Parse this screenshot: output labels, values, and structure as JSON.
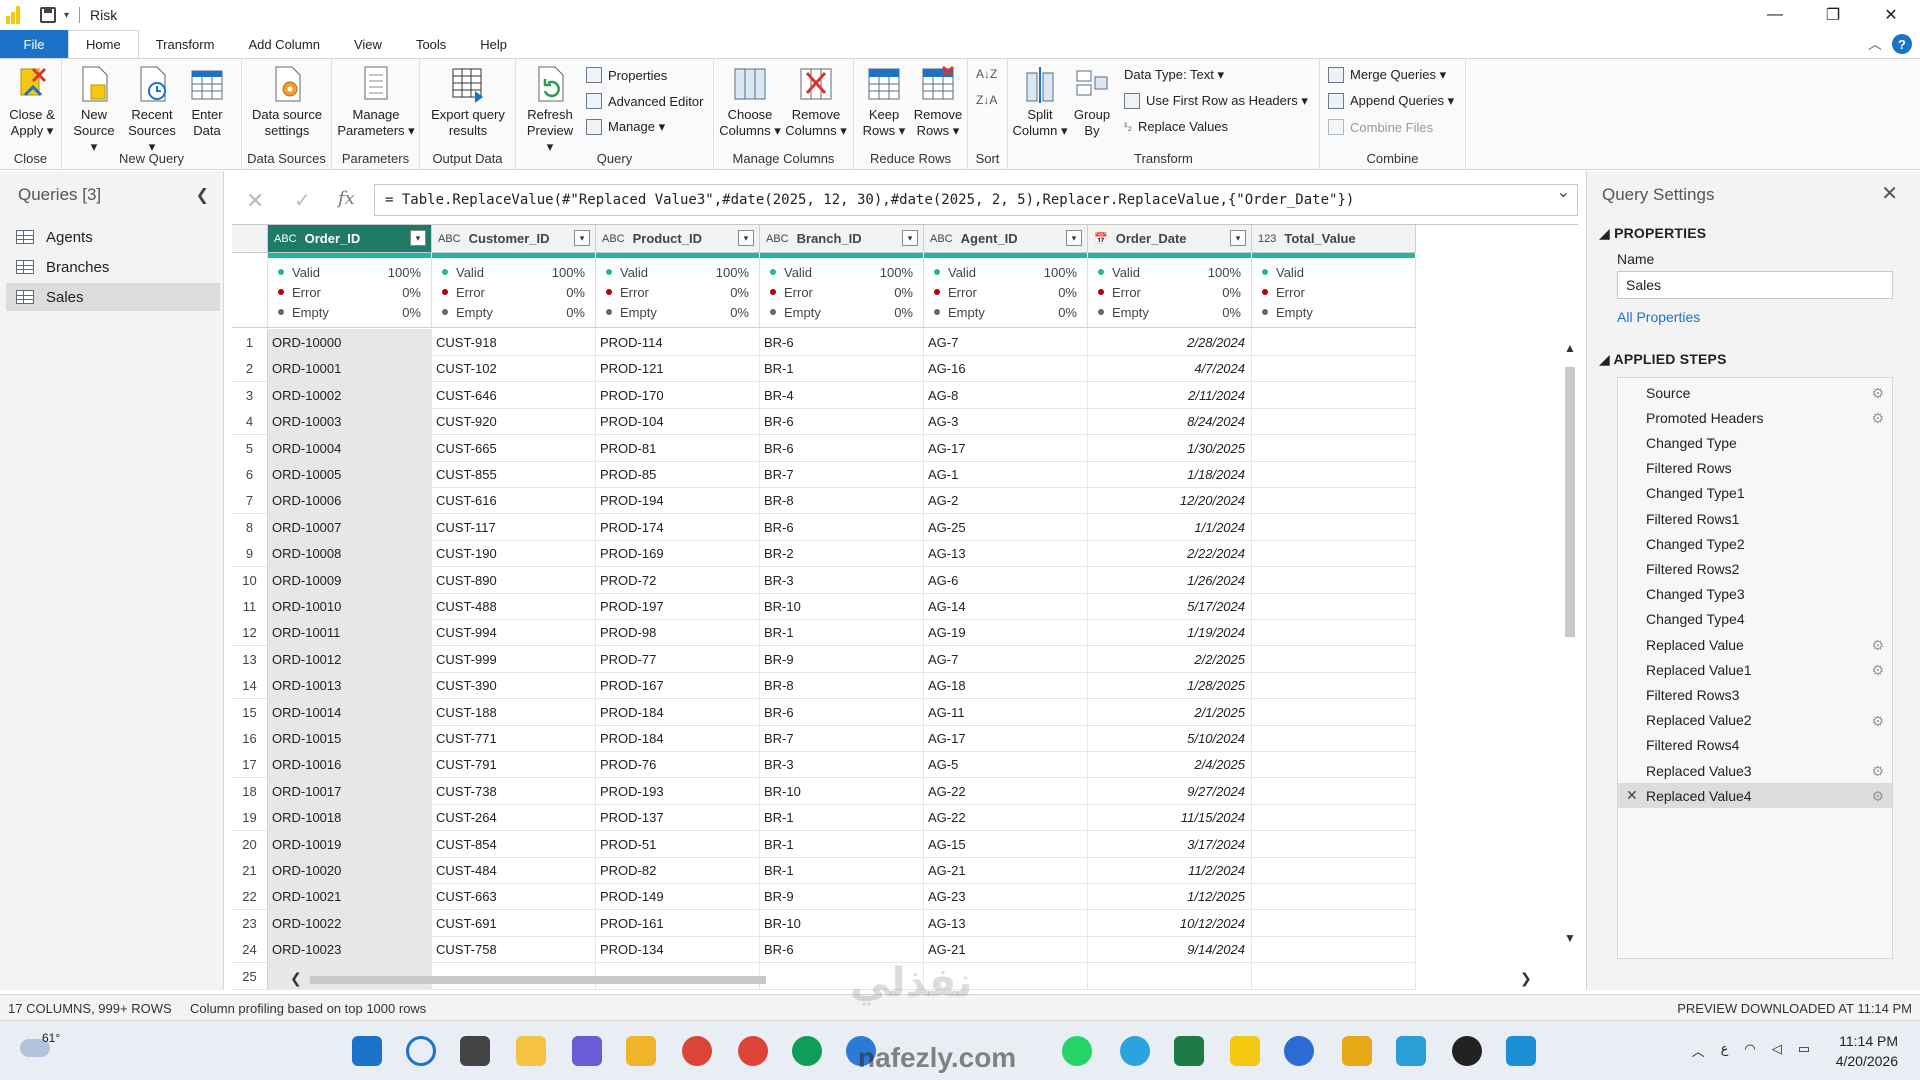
{
  "titlebar": {
    "title": "Risk",
    "minimize": "—",
    "restore": "❐",
    "close": "✕"
  },
  "menu": {
    "tabs": [
      "File",
      "Home",
      "Transform",
      "Add Column",
      "View",
      "Tools",
      "Help"
    ],
    "help_icon": "?"
  },
  "ribbon": {
    "close_apply": "Close &\nApply ▾",
    "new_source": "New\nSource ▾",
    "recent_sources": "Recent\nSources ▾",
    "enter_data": "Enter\nData",
    "data_source_settings": "Data source\nsettings",
    "manage_parameters": "Manage\nParameters ▾",
    "export_query": "Export query\nresults",
    "refresh_preview": "Refresh\nPreview ▾",
    "properties": "Properties",
    "advanced_editor": "Advanced Editor",
    "manage": "Manage ▾",
    "choose_columns": "Choose\nColumns ▾",
    "remove_columns": "Remove\nColumns ▾",
    "keep_rows": "Keep\nRows ▾",
    "remove_rows": "Remove\nRows ▾",
    "split_column": "Split\nColumn ▾",
    "group_by": "Group\nBy",
    "data_type": "Data Type: Text ▾",
    "first_row_headers": "Use First Row as Headers ▾",
    "replace_values": "Replace Values",
    "merge_queries": "Merge Queries ▾",
    "append_queries": "Append Queries ▾",
    "combine_files": "Combine Files",
    "groups": [
      "Close",
      "New Query",
      "Data Sources",
      "Parameters",
      "Output Data",
      "Query",
      "Manage Columns",
      "Reduce Rows",
      "Sort",
      "Transform",
      "Combine"
    ]
  },
  "queries": {
    "header": "Queries [3]",
    "collapse_icon": "❮",
    "items": [
      "Agents",
      "Branches",
      "Sales"
    ],
    "selected": "Sales"
  },
  "formula": {
    "cancel_icon": "✕",
    "commit_icon": "✓",
    "fx": "fx",
    "text": "= Table.ReplaceValue(#\"Replaced Value3\",#date(2025, 12, 30),#date(2025, 2, 5),Replacer.ReplaceValue,{\"Order_Date\"})",
    "expand_icon": "⌄"
  },
  "grid": {
    "columns": [
      {
        "name": "Order_ID",
        "type": "ABC"
      },
      {
        "name": "Customer_ID",
        "type": "ABC"
      },
      {
        "name": "Product_ID",
        "type": "ABC"
      },
      {
        "name": "Branch_ID",
        "type": "ABC"
      },
      {
        "name": "Agent_ID",
        "type": "ABC"
      },
      {
        "name": "Order_Date",
        "type": "📅"
      },
      {
        "name": "Total_Value",
        "type": "123"
      }
    ],
    "profile": {
      "valid": "Valid",
      "error": "Error",
      "empty": "Empty",
      "valid_pct": "100%",
      "error_pct": "0%",
      "empty_pct": "0%"
    },
    "rows": [
      [
        "1",
        "ORD-10000",
        "CUST-918",
        "PROD-114",
        "BR-6",
        "AG-7",
        "2/28/2024"
      ],
      [
        "2",
        "ORD-10001",
        "CUST-102",
        "PROD-121",
        "BR-1",
        "AG-16",
        "4/7/2024"
      ],
      [
        "3",
        "ORD-10002",
        "CUST-646",
        "PROD-170",
        "BR-4",
        "AG-8",
        "2/11/2024"
      ],
      [
        "4",
        "ORD-10003",
        "CUST-920",
        "PROD-104",
        "BR-6",
        "AG-3",
        "8/24/2024"
      ],
      [
        "5",
        "ORD-10004",
        "CUST-665",
        "PROD-81",
        "BR-6",
        "AG-17",
        "1/30/2025"
      ],
      [
        "6",
        "ORD-10005",
        "CUST-855",
        "PROD-85",
        "BR-7",
        "AG-1",
        "1/18/2024"
      ],
      [
        "7",
        "ORD-10006",
        "CUST-616",
        "PROD-194",
        "BR-8",
        "AG-2",
        "12/20/2024"
      ],
      [
        "8",
        "ORD-10007",
        "CUST-117",
        "PROD-174",
        "BR-6",
        "AG-25",
        "1/1/2024"
      ],
      [
        "9",
        "ORD-10008",
        "CUST-190",
        "PROD-169",
        "BR-2",
        "AG-13",
        "2/22/2024"
      ],
      [
        "10",
        "ORD-10009",
        "CUST-890",
        "PROD-72",
        "BR-3",
        "AG-6",
        "1/26/2024"
      ],
      [
        "11",
        "ORD-10010",
        "CUST-488",
        "PROD-197",
        "BR-10",
        "AG-14",
        "5/17/2024"
      ],
      [
        "12",
        "ORD-10011",
        "CUST-994",
        "PROD-98",
        "BR-1",
        "AG-19",
        "1/19/2024"
      ],
      [
        "13",
        "ORD-10012",
        "CUST-999",
        "PROD-77",
        "BR-9",
        "AG-7",
        "2/2/2025"
      ],
      [
        "14",
        "ORD-10013",
        "CUST-390",
        "PROD-167",
        "BR-8",
        "AG-18",
        "1/28/2025"
      ],
      [
        "15",
        "ORD-10014",
        "CUST-188",
        "PROD-184",
        "BR-6",
        "AG-11",
        "2/1/2025"
      ],
      [
        "16",
        "ORD-10015",
        "CUST-771",
        "PROD-184",
        "BR-7",
        "AG-17",
        "5/10/2024"
      ],
      [
        "17",
        "ORD-10016",
        "CUST-791",
        "PROD-76",
        "BR-3",
        "AG-5",
        "2/4/2025"
      ],
      [
        "18",
        "ORD-10017",
        "CUST-738",
        "PROD-193",
        "BR-10",
        "AG-22",
        "9/27/2024"
      ],
      [
        "19",
        "ORD-10018",
        "CUST-264",
        "PROD-137",
        "BR-1",
        "AG-22",
        "11/15/2024"
      ],
      [
        "20",
        "ORD-10019",
        "CUST-854",
        "PROD-51",
        "BR-1",
        "AG-15",
        "3/17/2024"
      ],
      [
        "21",
        "ORD-10020",
        "CUST-484",
        "PROD-82",
        "BR-1",
        "AG-21",
        "11/2/2024"
      ],
      [
        "22",
        "ORD-10021",
        "CUST-663",
        "PROD-149",
        "BR-9",
        "AG-23",
        "1/12/2025"
      ],
      [
        "23",
        "ORD-10022",
        "CUST-691",
        "PROD-161",
        "BR-10",
        "AG-13",
        "10/12/2024"
      ],
      [
        "24",
        "ORD-10023",
        "CUST-758",
        "PROD-134",
        "BR-6",
        "AG-21",
        "9/14/2024"
      ],
      [
        "25",
        "",
        "",
        "",
        "",
        "",
        ""
      ]
    ]
  },
  "settings": {
    "header": "Query Settings",
    "close_icon": "✕",
    "properties": "PROPERTIES",
    "name_label": "Name",
    "name_value": "Sales",
    "all_properties": "All Properties",
    "applied_steps": "APPLIED STEPS",
    "steps": [
      {
        "label": "Source",
        "gear": true
      },
      {
        "label": "Promoted Headers",
        "gear": true
      },
      {
        "label": "Changed Type",
        "gear": false
      },
      {
        "label": "Filtered Rows",
        "gear": false
      },
      {
        "label": "Changed Type1",
        "gear": false
      },
      {
        "label": "Filtered Rows1",
        "gear": false
      },
      {
        "label": "Changed Type2",
        "gear": false
      },
      {
        "label": "Filtered Rows2",
        "gear": false
      },
      {
        "label": "Changed Type3",
        "gear": false
      },
      {
        "label": "Changed Type4",
        "gear": false
      },
      {
        "label": "Replaced Value",
        "gear": true
      },
      {
        "label": "Replaced Value1",
        "gear": true
      },
      {
        "label": "Filtered Rows3",
        "gear": false
      },
      {
        "label": "Replaced Value2",
        "gear": true
      },
      {
        "label": "Filtered Rows4",
        "gear": false
      },
      {
        "label": "Replaced Value3",
        "gear": true
      },
      {
        "label": "Replaced Value4",
        "gear": true
      }
    ],
    "selected_step": "Replaced Value4"
  },
  "status": {
    "counts": "17 COLUMNS, 999+ ROWS",
    "profiling": "Column profiling based on top 1000 rows",
    "preview": "PREVIEW DOWNLOADED AT 11:14 PM"
  },
  "taskbar": {
    "weather": "61°",
    "time": "11:14 PM",
    "date": "4/20/2026",
    "tray_lang": "ع"
  },
  "watermark": {
    "brand": "nafezly.com",
    "arabic": "نفذلي"
  },
  "colors": {
    "accent": "#1a73c8",
    "selected_col": "#1f7a67",
    "quality": "#1fb7a0"
  }
}
